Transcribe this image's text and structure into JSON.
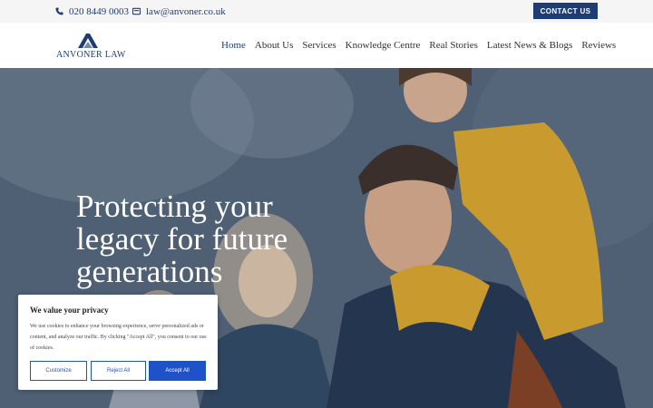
{
  "topbar": {
    "phone": "020 8449 0003",
    "email": "law@anvoner.co.uk",
    "contact_button": "CONTACT US",
    "phone_icon": "phone-icon",
    "email_icon": "mail-icon"
  },
  "header": {
    "logo_text": "ANVONER LAW",
    "nav": [
      {
        "label": "Home"
      },
      {
        "label": "About Us"
      },
      {
        "label": "Services"
      },
      {
        "label": "Knowledge Centre"
      },
      {
        "label": "Real Stories"
      },
      {
        "label": "Latest News & Blogs"
      },
      {
        "label": "Reviews"
      }
    ]
  },
  "hero": {
    "title": "Protecting your legacy for future generations"
  },
  "cookie": {
    "title": "We value your privacy",
    "text": "We use cookies to enhance your browsing experience, serve personalized ads or content, and analyze our traffic. By clicking \"Accept All\", you consent to our use of cookies.",
    "customize": "Customize",
    "reject": "Reject All",
    "accept": "Accept All"
  },
  "colors": {
    "brand": "#1f3d75",
    "accent_button": "#1f52c8"
  }
}
